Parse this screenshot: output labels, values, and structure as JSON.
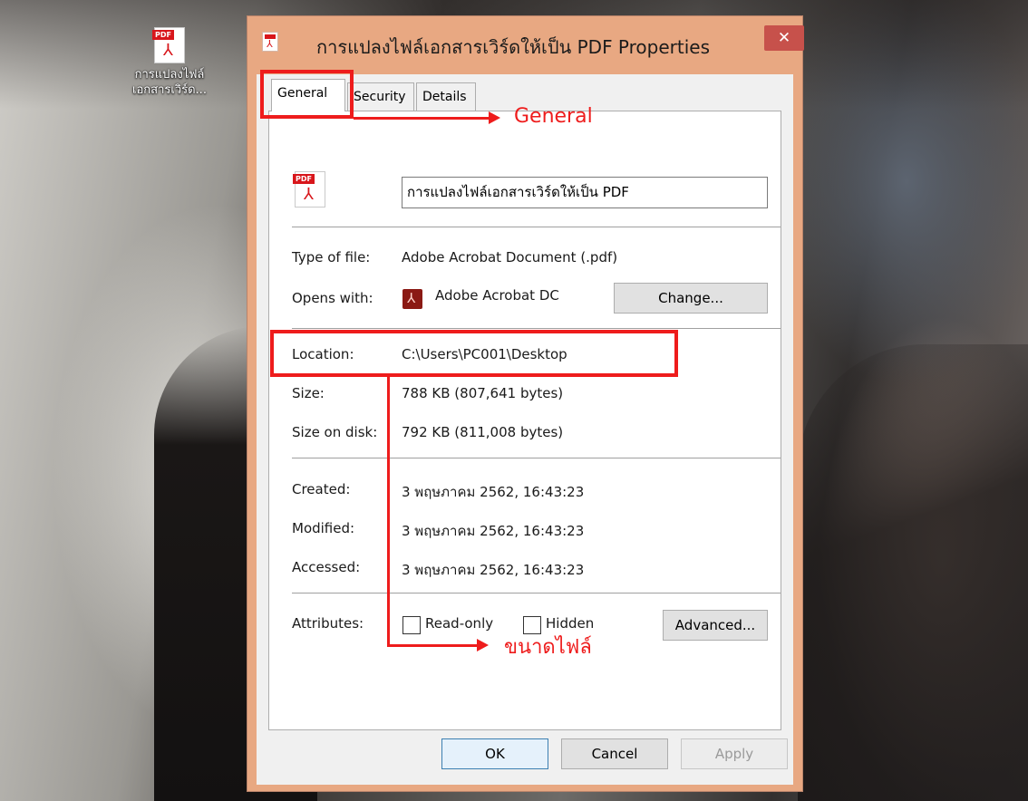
{
  "desktop": {
    "icon_label_line1": "การแปลงไฟล์",
    "icon_label_line2": "เอกสารเวิร์ด..."
  },
  "dialog": {
    "title": "การแปลงไฟล์เอกสารเวิร์ดให้เป็น PDF Properties",
    "close_glyph": "✕",
    "tabs": [
      "General",
      "Security",
      "Details"
    ],
    "file_name": "การแปลงไฟล์เอกสารเวิร์ดให้เป็น PDF",
    "type_label": "Type of file:",
    "type_value": "Adobe Acrobat Document (.pdf)",
    "opens_label": "Opens with:",
    "opens_value": "Adobe Acrobat DC",
    "change_button": "Change...",
    "location_label": "Location:",
    "location_value": "C:\\Users\\PC001\\Desktop",
    "size_label": "Size:",
    "size_value": "788 KB (807,641 bytes)",
    "size_disk_label": "Size on disk:",
    "size_disk_value": "792 KB (811,008 bytes)",
    "created_label": "Created:",
    "created_value": "3 พฤษภาคม 2562, 16:43:23",
    "modified_label": "Modified:",
    "modified_value": "3 พฤษภาคม 2562, 16:43:23",
    "accessed_label": "Accessed:",
    "accessed_value": "3 พฤษภาคม 2562, 16:43:23",
    "attributes_label": "Attributes:",
    "readonly_label": "Read-only",
    "hidden_label": "Hidden",
    "advanced_button": "Advanced...",
    "ok_button": "OK",
    "cancel_button": "Cancel",
    "apply_button": "Apply"
  },
  "annotations": {
    "general_callout": "General",
    "size_callout": "ขนาดไฟล์",
    "color": "#ee1c1c"
  },
  "icons": {
    "pdf_badge": "PDF",
    "pdf_symbol": "⅄"
  }
}
